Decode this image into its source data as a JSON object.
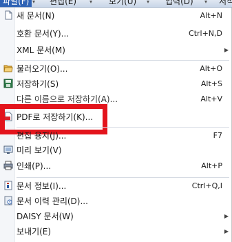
{
  "menubar": {
    "items": [
      {
        "label": "파일(F)"
      },
      {
        "label": "편집(E)"
      },
      {
        "label": "보기(U)"
      },
      {
        "label": "입력(D)"
      },
      {
        "label": "서식"
      }
    ]
  },
  "menu": {
    "new_doc": {
      "label": "새 문서(N)",
      "shortcut": "Alt+N"
    },
    "compat_doc": {
      "label": "호환 문서(Y)...",
      "shortcut": "Ctrl+N,D"
    },
    "xml_doc": {
      "label": "XML 문서(M)"
    },
    "open": {
      "label": "불러오기(O)...",
      "shortcut": "Alt+O"
    },
    "save": {
      "label": "저장하기(S)",
      "shortcut": "Alt+S"
    },
    "save_as": {
      "label": "다른 이름으로 저장하기(A)...",
      "shortcut": "Alt+V"
    },
    "save_pdf": {
      "label": "PDF로 저장하기(K)..."
    },
    "page_setup": {
      "label": "편집 용지(J)...",
      "shortcut": "F7"
    },
    "preview": {
      "label": "미리 보기(V)"
    },
    "print": {
      "label": "인쇄(P)...",
      "shortcut": "Alt+P"
    },
    "doc_info": {
      "label": "문서 정보(I)...",
      "shortcut": "Ctrl+Q,I"
    },
    "history": {
      "label": "문서 이력 관리(D)..."
    },
    "daisy": {
      "label": "DAISY 문서(W)"
    },
    "send": {
      "label": "보내기(E)"
    }
  },
  "colors": {
    "highlight": "#e3141c",
    "menubar_active": "#2f63b5"
  }
}
